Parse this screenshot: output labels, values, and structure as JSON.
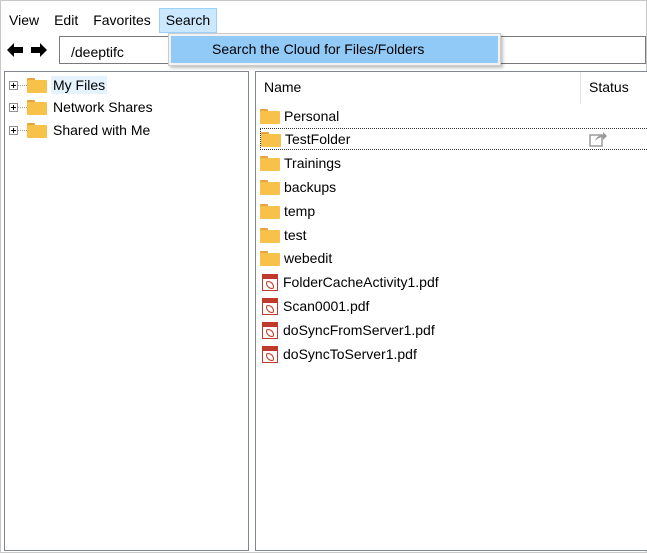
{
  "menu": {
    "items": [
      "View",
      "Edit",
      "Favorites",
      "Search"
    ],
    "active": "Search",
    "dropdown_item": "Search the Cloud for Files/Folders"
  },
  "toolbar": {
    "back_icon": "back-arrow-icon",
    "forward_icon": "forward-arrow-icon",
    "path": "/deeptifc"
  },
  "tree": {
    "items": [
      {
        "label": "My Files",
        "selected": true
      },
      {
        "label": "Network Shares",
        "selected": false
      },
      {
        "label": "Shared with Me",
        "selected": false
      }
    ]
  },
  "list": {
    "columns": {
      "name": "Name",
      "status": "Status"
    },
    "folders": [
      "Personal",
      "TestFolder",
      "Trainings",
      "backups",
      "temp",
      "test",
      "webedit"
    ],
    "files": [
      "FolderCacheActivity1.pdf",
      "Scan0001.pdf",
      "doSyncFromServer1.pdf",
      "doSyncToServer1.pdf"
    ],
    "focused_item": "TestFolder",
    "status_icon": "shared-status-icon"
  },
  "colors": {
    "menu_active": "#cce8ff",
    "dropdown_highlight": "#91c9f7",
    "folder": "#f8c14a",
    "pdf": "#c0392b"
  }
}
